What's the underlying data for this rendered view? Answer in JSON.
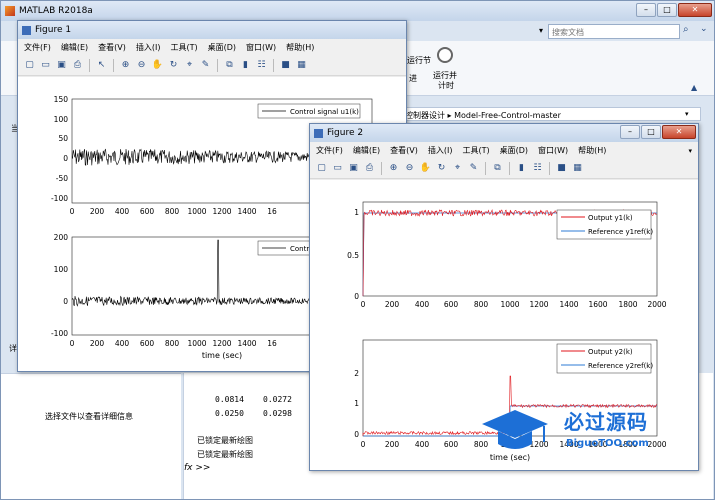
{
  "matlab": {
    "title": "MATLAB R2018a",
    "search_placeholder": "搜索文档",
    "ribbon_item1": "运行节",
    "ribbon_item2": "运行并\n计时",
    "ribbon_run_label": "运行并",
    "ribbon_run_label2": "计时",
    "ribbon_fragment": "进",
    "path_part1": "控制器设计",
    "path_part2": "Model-Free-Control-master",
    "detail_text": "选择文件以查看详细信息",
    "cmd_row1_a": "0.0814",
    "cmd_row1_b": "0.0272",
    "cmd_row2_a": "0.0250",
    "cmd_row2_b": "0.0298",
    "cmd_msg1": "已锁定最新绘图",
    "cmd_msg2": "已锁定最新绘图",
    "prompt": "fx >>",
    "left_char1": "当",
    "left_char2": "详"
  },
  "menu": [
    "文件(F)",
    "编辑(E)",
    "查看(V)",
    "插入(I)",
    "工具(T)",
    "桌面(D)",
    "窗口(W)",
    "帮助(H)"
  ],
  "figure1": {
    "title": "Figure 1",
    "ax1": {
      "legend": "Control signal u1(k)",
      "yticks": [
        "150",
        "100",
        "50",
        "0",
        "-50",
        "-100"
      ],
      "xticks": [
        "0",
        "200",
        "400",
        "600",
        "800",
        "1000",
        "1200",
        "1400",
        "16"
      ]
    },
    "ax2": {
      "legend": "Contro",
      "yticks": [
        "200",
        "100",
        "0",
        "-100"
      ],
      "xticks": [
        "0",
        "200",
        "400",
        "600",
        "800",
        "1000",
        "1200",
        "1400",
        "16"
      ]
    },
    "xlabel": "time (sec)"
  },
  "figure2": {
    "title": "Figure 2",
    "ax1": {
      "legend1": "Output y1(k)",
      "legend2": "Reference y1ref(k)",
      "yticks": [
        "1",
        "0.5",
        "0"
      ],
      "xticks": [
        "0",
        "200",
        "400",
        "600",
        "800",
        "1000",
        "1200",
        "1400",
        "1600",
        "1800",
        "2000"
      ]
    },
    "ax2": {
      "legend1": "Output y2(k)",
      "legend2": "Reference y2ref(k)",
      "yticks": [
        "2",
        "1",
        "0"
      ],
      "xticks": [
        "0",
        "200",
        "400",
        "600",
        "800",
        "1000",
        "1200",
        "1400",
        "1600",
        "1800",
        "2000"
      ]
    },
    "xlabel": "time (sec)"
  },
  "watermark": {
    "main": "必过源码",
    "sub": "BiguoTOO.com"
  }
}
